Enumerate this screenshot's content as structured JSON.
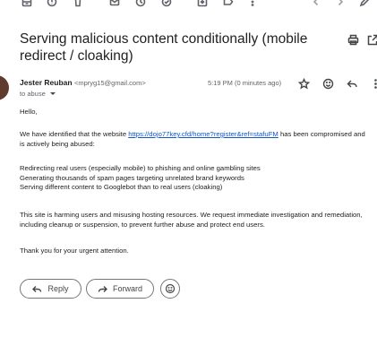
{
  "email": {
    "subject": "Serving malicious content conditionally (mobile redirect / cloaking)",
    "sender_name": "Jester Reuban",
    "sender_email": "<mpryg15@gmail.com>",
    "to": "to abuse",
    "timestamp": "5:19 PM (0 minutes ago)",
    "greeting": "Hello,",
    "intro_before_link": "We have identified that the website ",
    "link_text": "https://dojo77key.cfd/home?register&ref=stafuFM",
    "intro_after_link": " has been compromised and is actively being abused:",
    "points": [
      "Redirecting real users (especially mobile) to phishing and online gambling sites",
      "Generating thousands of spam pages targeting unrelated brand keywords",
      "Serving different content to Googlebot than to real users (cloaking)"
    ],
    "request": "This site is harming users and misusing hosting resources. We request immediate investigation and remediation, including cleanup or suspension, to prevent further abuse and protect end users.",
    "closing": "Thank you for your urgent attention."
  },
  "actions": {
    "reply_label": "Reply",
    "forward_label": "Forward"
  },
  "icons": {
    "toolbar": [
      "archive-icon",
      "report-spam-icon",
      "delete-icon",
      "mark-unread-icon",
      "snooze-icon",
      "add-task-icon",
      "move-to-icon",
      "label-icon",
      "more-vert-icon",
      "prev-icon",
      "next-icon",
      "pen-icon"
    ],
    "header": [
      "star-icon",
      "emoji-icon",
      "reply-icon",
      "more-vert-icon"
    ]
  },
  "colors": {
    "link": "#1155cc",
    "avatar": "#5f3b2e",
    "text": "#202124",
    "muted": "#5f6368"
  }
}
